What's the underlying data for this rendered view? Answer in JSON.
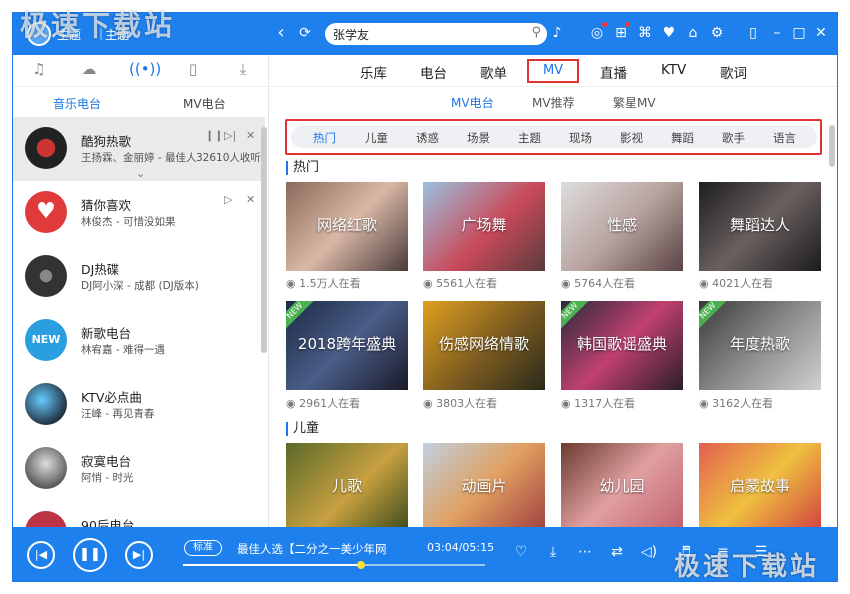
{
  "titlebar": {
    "search_value": "张学友",
    "partial_text_1": "主题",
    "partial_text_2": "主题"
  },
  "left_icons": [
    "music-note-icon",
    "cloud-icon",
    "radio-icon",
    "phone-icon",
    "download-icon"
  ],
  "left_tabs": {
    "music": "音乐电台",
    "mv": "MV电台"
  },
  "radio_list": [
    {
      "name": "酷狗热歌",
      "sub": "王扬霖、金丽婷 - 最佳人",
      "listeners": "32610人收听"
    },
    {
      "name": "猜你喜欢",
      "sub": "林俊杰 - 可惜没如果"
    },
    {
      "name": "DJ热碟",
      "sub": "DJ阿小深 - 成都 (DJ版本)"
    },
    {
      "name": "新歌电台",
      "sub": "林宥嘉 - 难得一遇"
    },
    {
      "name": "KTV必点曲",
      "sub": "汪峰 - 再见青春"
    },
    {
      "name": "寂寞电台",
      "sub": "阿悄 - 时光"
    },
    {
      "name": "90后电台",
      "sub": ""
    }
  ],
  "nav": [
    "乐库",
    "电台",
    "歌单",
    "MV",
    "直播",
    "KTV",
    "歌词"
  ],
  "subnav": [
    "MV电台",
    "MV推荐",
    "繁星MV"
  ],
  "categories": [
    "热门",
    "儿童",
    "诱惑",
    "场景",
    "主题",
    "现场",
    "影视",
    "舞蹈",
    "歌手",
    "语言"
  ],
  "sections": {
    "hot": {
      "title": "热门",
      "cards": [
        {
          "title": "网络红歌",
          "count": "1.5万人在看"
        },
        {
          "title": "广场舞",
          "count": "5561人在看"
        },
        {
          "title": "性感",
          "count": "5764人在看"
        },
        {
          "title": "舞蹈达人",
          "count": "4021人在看"
        },
        {
          "title": "2018跨年盛典",
          "count": "2961人在看"
        },
        {
          "title": "伤感网络情歌",
          "count": "3803人在看"
        },
        {
          "title": "韩国歌谣盛典",
          "count": "1317人在看"
        },
        {
          "title": "年度热歌",
          "count": "3162人在看"
        }
      ]
    },
    "kids": {
      "title": "儿童",
      "cards": [
        {
          "title": "儿歌"
        },
        {
          "title": "动画片"
        },
        {
          "title": "幼儿园"
        },
        {
          "title": "启蒙故事"
        }
      ]
    }
  },
  "new_tag": "NEW",
  "player": {
    "quality": "标准",
    "song": "最佳人选【二分之一美少年网",
    "time": "03:04/05:15",
    "progress": 0.59
  },
  "watermark": "极速下载站",
  "colors": {
    "brand": "#1e80ed",
    "highlight": "#dd3333"
  }
}
